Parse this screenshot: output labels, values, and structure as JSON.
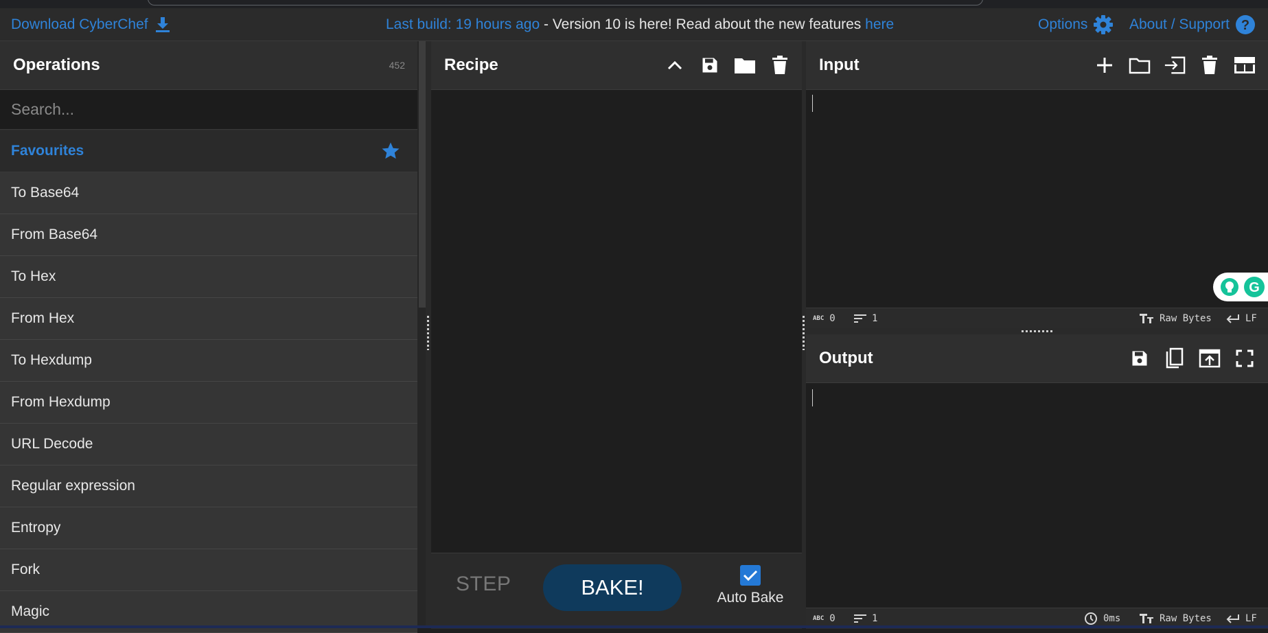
{
  "banner": {
    "download_label": "Download CyberChef",
    "last_build_link": "Last build: 19 hours ago",
    "notice_text": " - Version 10 is here! Read about the new features ",
    "notice_link": "here",
    "options_label": "Options",
    "about_label": "About / Support",
    "accent_color": "#2f83d9"
  },
  "operations": {
    "title": "Operations",
    "count": "452",
    "search_placeholder": "Search...",
    "favourites_label": "Favourites",
    "items": [
      "To Base64",
      "From Base64",
      "To Hex",
      "From Hex",
      "To Hexdump",
      "From Hexdump",
      "URL Decode",
      "Regular expression",
      "Entropy",
      "Fork",
      "Magic"
    ]
  },
  "recipe": {
    "title": "Recipe",
    "icons": [
      "chevron-up-icon",
      "save-icon",
      "folder-icon",
      "trash-icon"
    ],
    "step_label": "STEP",
    "bake_label": "BAKE!",
    "auto_bake_label": "Auto Bake",
    "auto_bake_checked": true
  },
  "input": {
    "title": "Input",
    "icons": [
      "plus-icon",
      "folder-icon",
      "import-icon",
      "trash-icon",
      "layout-icon"
    ],
    "status": {
      "chars_label": "ABC",
      "chars": "0",
      "lines": "1",
      "encoding": "Raw Bytes",
      "eol": "LF"
    }
  },
  "output": {
    "title": "Output",
    "icons": [
      "save-icon",
      "copy-icon",
      "replace-input-icon",
      "maximise-icon"
    ],
    "status": {
      "chars_label": "ABC",
      "chars": "0",
      "lines": "1",
      "time": "0ms",
      "encoding": "Raw Bytes",
      "eol": "LF"
    }
  }
}
